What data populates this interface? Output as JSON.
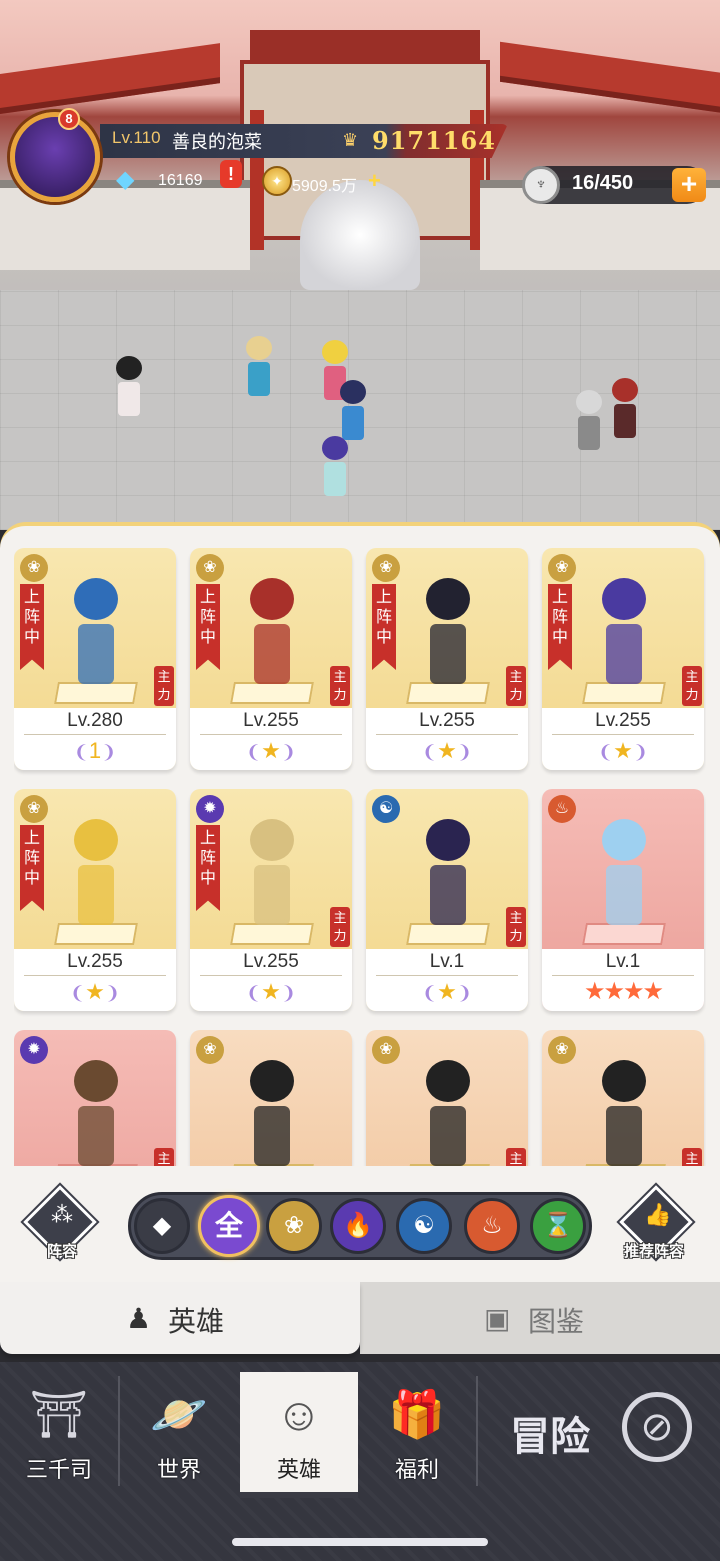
{
  "player": {
    "level": "Lv.110",
    "name": "善良的泡菜",
    "power": "9171164",
    "avatar_badge": "8"
  },
  "resources": {
    "gems": "16169",
    "gems_alert": "!",
    "gold": "5909.5万",
    "gold_plus": "+",
    "stamina": "16/450",
    "stamina_add": "+"
  },
  "heroes": [
    {
      "level": "Lv.280",
      "deployed": true,
      "deploy_label": "上阵中",
      "main_tag": "主力",
      "faction_icon": "lotus-icon",
      "rank": "1",
      "bg": "gold",
      "color": "#2f6db8"
    },
    {
      "level": "Lv.255",
      "deployed": true,
      "deploy_label": "上阵中",
      "main_tag": "主力",
      "faction_icon": "lotus-icon",
      "rank": "★",
      "bg": "gold",
      "color": "#a8302a"
    },
    {
      "level": "Lv.255",
      "deployed": true,
      "deploy_label": "上阵中",
      "main_tag": "主力",
      "faction_icon": "lotus-icon",
      "rank": "★",
      "bg": "gold",
      "color": "#222230"
    },
    {
      "level": "Lv.255",
      "deployed": true,
      "deploy_label": "上阵中",
      "main_tag": "主力",
      "faction_icon": "lotus-icon",
      "rank": "★",
      "bg": "gold",
      "color": "#4a3aa0"
    },
    {
      "level": "Lv.255",
      "deployed": true,
      "deploy_label": "上阵中",
      "main_tag": "",
      "faction_icon": "lotus-icon",
      "rank": "★",
      "bg": "gold",
      "color": "#e8c040"
    },
    {
      "level": "Lv.255",
      "deployed": true,
      "deploy_label": "上阵中",
      "main_tag": "主力",
      "faction_icon": "flame-icon",
      "rank": "★",
      "bg": "gold",
      "color": "#d8c080"
    },
    {
      "level": "Lv.1",
      "deployed": false,
      "deploy_label": "",
      "main_tag": "主力",
      "faction_icon": "swirl-icon",
      "rank": "★",
      "bg": "gold",
      "color": "#2a2450"
    },
    {
      "level": "Lv.1",
      "deployed": false,
      "deploy_label": "",
      "main_tag": "",
      "faction_icon": "meditate-icon",
      "stars": "★★★★",
      "bg": "red",
      "color": "#9ed0f0"
    },
    {
      "level": "",
      "deployed": false,
      "deploy_label": "",
      "main_tag": "主",
      "faction_icon": "flame-icon",
      "bg": "red",
      "color": "#6a4a30"
    },
    {
      "level": "",
      "deployed": false,
      "deploy_label": "",
      "main_tag": "",
      "faction_icon": "lotus-icon",
      "bg": "org",
      "color": "#222"
    },
    {
      "level": "",
      "deployed": false,
      "deploy_label": "",
      "main_tag": "主",
      "faction_icon": "lotus-icon",
      "bg": "org",
      "color": "#222"
    },
    {
      "level": "",
      "deployed": false,
      "deploy_label": "",
      "main_tag": "主",
      "faction_icon": "lotus-icon",
      "bg": "org",
      "color": "#222"
    }
  ],
  "filters": {
    "lineup_label": "阵容",
    "recommend_label": "推荐阵容",
    "all_label": "全",
    "items": [
      {
        "name": "grade-filter",
        "glyph": "◆",
        "color": "#3a3c46"
      },
      {
        "name": "all",
        "glyph": "全",
        "color": "#7a4ad0"
      },
      {
        "name": "lotus",
        "glyph": "❀",
        "color": "#c9a040"
      },
      {
        "name": "flame",
        "glyph": "🔥",
        "color": "#5a3ab0"
      },
      {
        "name": "swirl",
        "glyph": "☯",
        "color": "#2a6ab0"
      },
      {
        "name": "meditate",
        "glyph": "♨",
        "color": "#d85a30"
      },
      {
        "name": "dna",
        "glyph": "⌛",
        "color": "#3aa040"
      }
    ]
  },
  "tabs": {
    "hero": "英雄",
    "codex": "图鉴"
  },
  "nav": {
    "home": "三千司",
    "world": "世界",
    "hero": "英雄",
    "welfare": "福利",
    "adventure": "冒险"
  },
  "colors": {
    "accent_gold": "#f0c060",
    "deploy_red": "#c7302a",
    "nav_bg": "#3a3b44"
  }
}
